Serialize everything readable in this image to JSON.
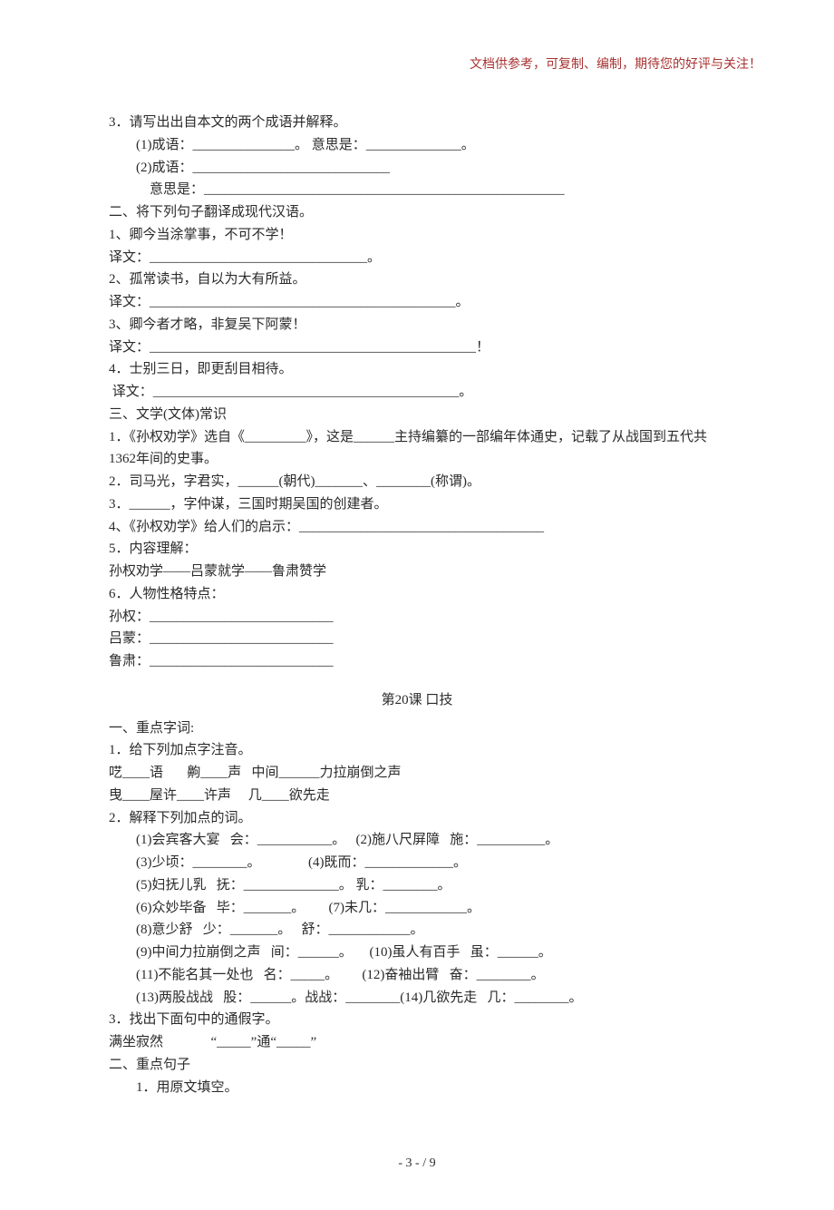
{
  "header_note": "文档供参考，可复制、编制，期待您的好评与关注！",
  "lines": [
    {
      "t": "3．请写出出自本文的两个成语并解释。",
      "cls": "line"
    },
    {
      "t": "(1)成语：_______________。 意思是：______________。",
      "cls": "line indent1"
    },
    {
      "t": "(2)成语：_____________________________",
      "cls": "line indent1"
    },
    {
      "t": "意思是：_____________________________________________________",
      "cls": "line indent2"
    },
    {
      "t": "二、将下列句子翻译成现代汉语。",
      "cls": "line"
    },
    {
      "t": "1、卿今当涂掌事，不可不学！",
      "cls": "line"
    },
    {
      "t": "译文：________________________________。",
      "cls": "line"
    },
    {
      "t": "2、孤常读书，自以为大有所益。",
      "cls": "line"
    },
    {
      "t": "译文：_____________________________________________。",
      "cls": "line"
    },
    {
      "t": "3、卿今者才略，非复吴下阿蒙！",
      "cls": "line"
    },
    {
      "t": "译文：________________________________________________！",
      "cls": "line"
    },
    {
      "t": "4．士别三日，即更刮目相待。",
      "cls": "line"
    },
    {
      "t": " 译文：_____________________________________________。",
      "cls": "line"
    },
    {
      "t": "三、文学(文体)常识",
      "cls": "line"
    },
    {
      "t": "1．《孙权劝学》选自《_________》，这是______主持编纂的一部编年体通史，记载了从战国到五代共1362年间的史事。",
      "cls": "line"
    },
    {
      "t": "2．司马光，字君实，______(朝代)_______、________(称谓)。",
      "cls": "line"
    },
    {
      "t": "3．______，字仲谋，三国时期吴国的创建者。",
      "cls": "line"
    },
    {
      "t": "4、《孙权劝学》给人们的启示：____________________________________",
      "cls": "line"
    },
    {
      "t": "5．内容理解：",
      "cls": "line"
    },
    {
      "t": "孙权劝学——吕蒙就学——鲁肃赞学",
      "cls": "line"
    },
    {
      "t": "6．人物性格特点：",
      "cls": "line"
    },
    {
      "t": "孙权：___________________________",
      "cls": "line"
    },
    {
      "t": "吕蒙：___________________________",
      "cls": "line"
    },
    {
      "t": "鲁肃：___________________________",
      "cls": "line"
    }
  ],
  "section_title_2": "第20课  口技",
  "lines2": [
    {
      "t": "一、重点字词:",
      "cls": "line"
    },
    {
      "t": "1．给下列加点字注音。",
      "cls": "line"
    },
    {
      "t": "呓____语       齁____声   中间______力拉崩倒之声",
      "cls": "line"
    },
    {
      "t": "曳____屋许____许声     几____欲先走",
      "cls": "line"
    },
    {
      "t": "2．解释下列加点的词。",
      "cls": "line"
    },
    {
      "t": "(1)会宾客大宴   会：___________。   (2)施八尺屏障   施：__________。",
      "cls": "line indent1"
    },
    {
      "t": "(3)少顷：________。              (4)既而：_____________。",
      "cls": "line indent1"
    },
    {
      "t": "(5)妇抚儿乳   抚：______________。 乳：________。",
      "cls": "line indent1"
    },
    {
      "t": "(6)众妙毕备   毕：_______。       (7)未几：____________。",
      "cls": "line indent1"
    },
    {
      "t": "(8)意少舒   少：_______。   舒：____________。",
      "cls": "line indent1"
    },
    {
      "t": "(9)中间力拉崩倒之声   间：______。     (10)虽人有百手   虽：______。",
      "cls": "line indent1"
    },
    {
      "t": "(11)不能名其一处也   名：_____。       (12)奋袖出臂   奋：________。",
      "cls": "line indent1"
    },
    {
      "t": "(13)两股战战   股：______。战战：________(14)几欲先走   几：________。",
      "cls": "line indent1"
    },
    {
      "t": "3．找出下面句中的通假字。",
      "cls": "line"
    },
    {
      "t": "满坐寂然              “_____”通“_____”",
      "cls": "line"
    },
    {
      "t": "二、重点句子",
      "cls": "line"
    },
    {
      "t": "1．用原文填空。",
      "cls": "line indent1"
    }
  ],
  "footer": "- 3 -  / 9"
}
